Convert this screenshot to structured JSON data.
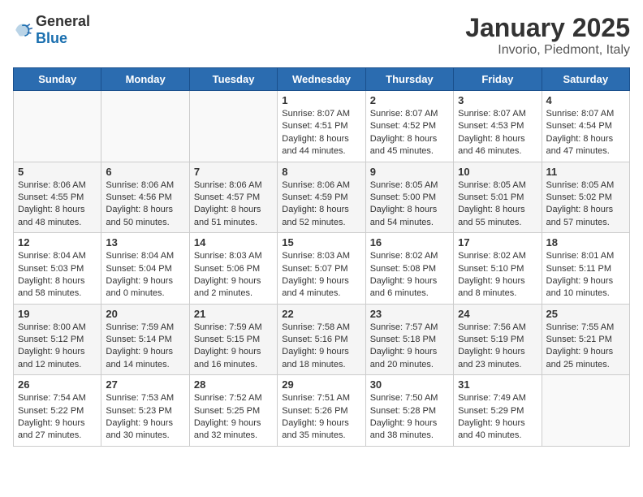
{
  "header": {
    "logo_general": "General",
    "logo_blue": "Blue",
    "month_title": "January 2025",
    "location": "Invorio, Piedmont, Italy"
  },
  "weekdays": [
    "Sunday",
    "Monday",
    "Tuesday",
    "Wednesday",
    "Thursday",
    "Friday",
    "Saturday"
  ],
  "weeks": [
    [
      {
        "day": "",
        "info": ""
      },
      {
        "day": "",
        "info": ""
      },
      {
        "day": "",
        "info": ""
      },
      {
        "day": "1",
        "info": "Sunrise: 8:07 AM\nSunset: 4:51 PM\nDaylight: 8 hours\nand 44 minutes."
      },
      {
        "day": "2",
        "info": "Sunrise: 8:07 AM\nSunset: 4:52 PM\nDaylight: 8 hours\nand 45 minutes."
      },
      {
        "day": "3",
        "info": "Sunrise: 8:07 AM\nSunset: 4:53 PM\nDaylight: 8 hours\nand 46 minutes."
      },
      {
        "day": "4",
        "info": "Sunrise: 8:07 AM\nSunset: 4:54 PM\nDaylight: 8 hours\nand 47 minutes."
      }
    ],
    [
      {
        "day": "5",
        "info": "Sunrise: 8:06 AM\nSunset: 4:55 PM\nDaylight: 8 hours\nand 48 minutes."
      },
      {
        "day": "6",
        "info": "Sunrise: 8:06 AM\nSunset: 4:56 PM\nDaylight: 8 hours\nand 50 minutes."
      },
      {
        "day": "7",
        "info": "Sunrise: 8:06 AM\nSunset: 4:57 PM\nDaylight: 8 hours\nand 51 minutes."
      },
      {
        "day": "8",
        "info": "Sunrise: 8:06 AM\nSunset: 4:59 PM\nDaylight: 8 hours\nand 52 minutes."
      },
      {
        "day": "9",
        "info": "Sunrise: 8:05 AM\nSunset: 5:00 PM\nDaylight: 8 hours\nand 54 minutes."
      },
      {
        "day": "10",
        "info": "Sunrise: 8:05 AM\nSunset: 5:01 PM\nDaylight: 8 hours\nand 55 minutes."
      },
      {
        "day": "11",
        "info": "Sunrise: 8:05 AM\nSunset: 5:02 PM\nDaylight: 8 hours\nand 57 minutes."
      }
    ],
    [
      {
        "day": "12",
        "info": "Sunrise: 8:04 AM\nSunset: 5:03 PM\nDaylight: 8 hours\nand 58 minutes."
      },
      {
        "day": "13",
        "info": "Sunrise: 8:04 AM\nSunset: 5:04 PM\nDaylight: 9 hours\nand 0 minutes."
      },
      {
        "day": "14",
        "info": "Sunrise: 8:03 AM\nSunset: 5:06 PM\nDaylight: 9 hours\nand 2 minutes."
      },
      {
        "day": "15",
        "info": "Sunrise: 8:03 AM\nSunset: 5:07 PM\nDaylight: 9 hours\nand 4 minutes."
      },
      {
        "day": "16",
        "info": "Sunrise: 8:02 AM\nSunset: 5:08 PM\nDaylight: 9 hours\nand 6 minutes."
      },
      {
        "day": "17",
        "info": "Sunrise: 8:02 AM\nSunset: 5:10 PM\nDaylight: 9 hours\nand 8 minutes."
      },
      {
        "day": "18",
        "info": "Sunrise: 8:01 AM\nSunset: 5:11 PM\nDaylight: 9 hours\nand 10 minutes."
      }
    ],
    [
      {
        "day": "19",
        "info": "Sunrise: 8:00 AM\nSunset: 5:12 PM\nDaylight: 9 hours\nand 12 minutes."
      },
      {
        "day": "20",
        "info": "Sunrise: 7:59 AM\nSunset: 5:14 PM\nDaylight: 9 hours\nand 14 minutes."
      },
      {
        "day": "21",
        "info": "Sunrise: 7:59 AM\nSunset: 5:15 PM\nDaylight: 9 hours\nand 16 minutes."
      },
      {
        "day": "22",
        "info": "Sunrise: 7:58 AM\nSunset: 5:16 PM\nDaylight: 9 hours\nand 18 minutes."
      },
      {
        "day": "23",
        "info": "Sunrise: 7:57 AM\nSunset: 5:18 PM\nDaylight: 9 hours\nand 20 minutes."
      },
      {
        "day": "24",
        "info": "Sunrise: 7:56 AM\nSunset: 5:19 PM\nDaylight: 9 hours\nand 23 minutes."
      },
      {
        "day": "25",
        "info": "Sunrise: 7:55 AM\nSunset: 5:21 PM\nDaylight: 9 hours\nand 25 minutes."
      }
    ],
    [
      {
        "day": "26",
        "info": "Sunrise: 7:54 AM\nSunset: 5:22 PM\nDaylight: 9 hours\nand 27 minutes."
      },
      {
        "day": "27",
        "info": "Sunrise: 7:53 AM\nSunset: 5:23 PM\nDaylight: 9 hours\nand 30 minutes."
      },
      {
        "day": "28",
        "info": "Sunrise: 7:52 AM\nSunset: 5:25 PM\nDaylight: 9 hours\nand 32 minutes."
      },
      {
        "day": "29",
        "info": "Sunrise: 7:51 AM\nSunset: 5:26 PM\nDaylight: 9 hours\nand 35 minutes."
      },
      {
        "day": "30",
        "info": "Sunrise: 7:50 AM\nSunset: 5:28 PM\nDaylight: 9 hours\nand 38 minutes."
      },
      {
        "day": "31",
        "info": "Sunrise: 7:49 AM\nSunset: 5:29 PM\nDaylight: 9 hours\nand 40 minutes."
      },
      {
        "day": "",
        "info": ""
      }
    ]
  ]
}
